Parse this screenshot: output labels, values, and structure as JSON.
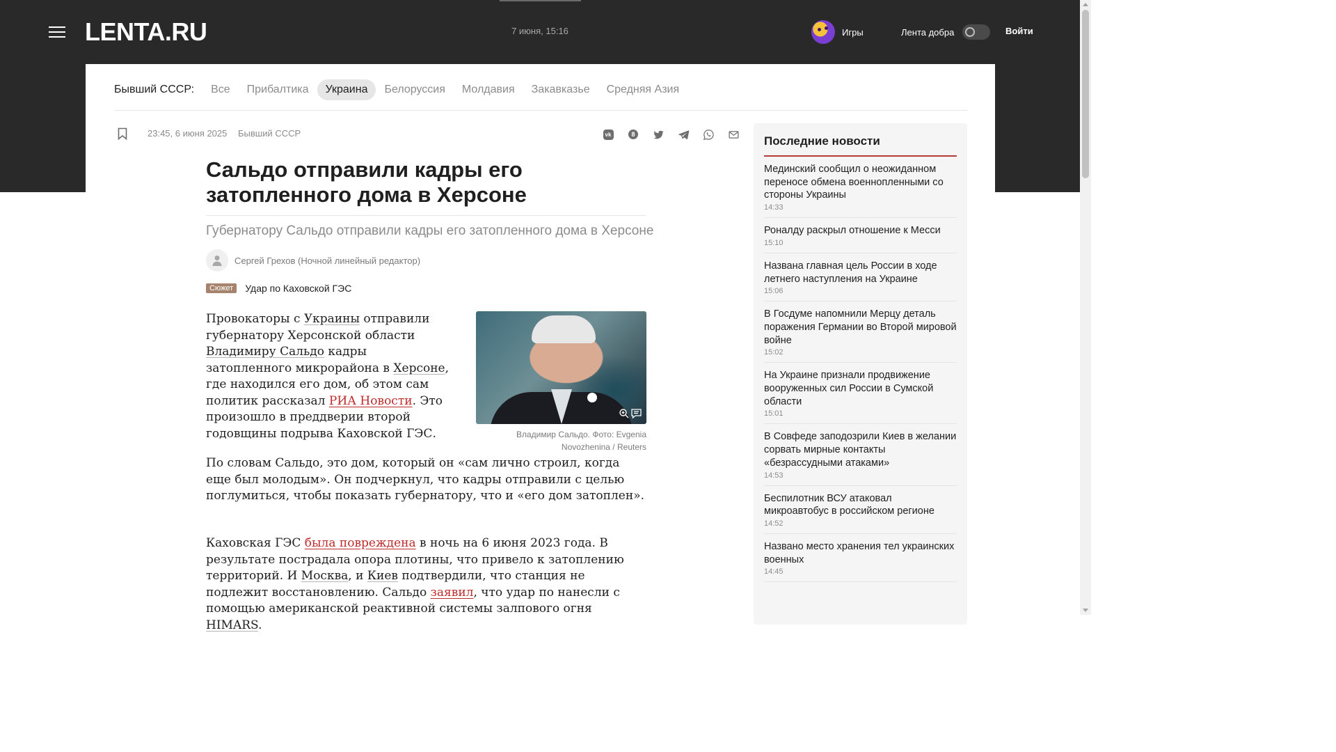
{
  "header": {
    "logo": "LENTA.RU",
    "date": "7 июня, 15:16",
    "games_label": "Игры",
    "kindness_label": "Лента добра",
    "kindness_toggle_on": false,
    "login_label": "Войти",
    "background_color": "#292929"
  },
  "rubrics": {
    "title": "Бывший СССР:",
    "items": [
      {
        "label": "Все",
        "active": false
      },
      {
        "label": "Прибалтика",
        "active": false
      },
      {
        "label": "Украина",
        "active": true
      },
      {
        "label": "Белоруссия",
        "active": false
      },
      {
        "label": "Молдавия",
        "active": false
      },
      {
        "label": "Закавказье",
        "active": false
      },
      {
        "label": "Средняя Азия",
        "active": false
      }
    ]
  },
  "article": {
    "date": "23:45, 6 июня 2025",
    "rubric": "Бывший СССР",
    "share_icons": [
      "vk-icon",
      "odnoklassniki-icon",
      "twitter-icon",
      "telegram-icon",
      "whatsapp-icon",
      "email-icon"
    ],
    "title": "Сальдо отправили кадры его затопленного дома в Херсоне",
    "subtitle": "Губернатору Сальдо отправили кадры его затопленного дома в Херсоне",
    "author": "Сергей Грехов (Ночной линейный редактор)",
    "story_badge": "Сюжет",
    "story_title": "Удар по Каховской ГЭС",
    "photo_caption": "Владимир Сальдо. Фото: Evgenia Novozhenina / Reuters",
    "p1": {
      "t1": "Провокаторы с ",
      "l1": "Украины",
      "t2": " отправили губернатору Херсонской области ",
      "l2": "Владимиру Сальдо",
      "t3": " кадры затопленного микрорайона в ",
      "l3": "Херсоне",
      "t4": ", где находился его дом, об этом сам политик рассказал ",
      "l4": "РИА Новости",
      "t5": ". Это произошло в преддверии второй годовщины подрыва Каховской ГЭС."
    },
    "p2": "По словам Сальдо, это дом, который он «сам лично строил, когда еще был молодым». Он подчеркнул, что кадры отправили с целью поглумиться, чтобы показать губернатору, что и «его дом затоплен».",
    "p3": {
      "t1": "Каховская ГЭС ",
      "l1": "была повреждена",
      "t2": " в ночь на 6 июня 2023 года. В результате пострадала опора плотины, что привело к затоплению территорий. И ",
      "l2": "Москва",
      "t3": ", и ",
      "l3": "Киев",
      "t4": " подтвердили, что станция не подлежит восстановлению. Сальдо ",
      "l4": "заявил",
      "t5": ", что удар по нанесли с помощью американской реактивной системы залпового огня ",
      "l5": "HIMARS",
      "t6": "."
    }
  },
  "sidebar": {
    "title": "Последние новости",
    "news": [
      {
        "title": "Мединский сообщил о неожиданном переносе обмена военнопленными со стороны Украины",
        "time": "14:33"
      },
      {
        "title": "Роналду раскрыл отношение к Месси",
        "time": "15:10"
      },
      {
        "title": "Названа главная цель России в ходе летнего наступления на Украине",
        "time": "15:06"
      },
      {
        "title": "В Госдуме напомнили Мерцу деталь поражения Германии во Второй мировой войне",
        "time": "15:02"
      },
      {
        "title": "На Украине признали продвижение вооруженных сил России в Сумской области",
        "time": "15:01"
      },
      {
        "title": "В Совфеде заподозрили Киев в желании сорвать мирные контакты «безрассудными атаками»",
        "time": "14:53"
      },
      {
        "title": "Беспилотник ВСУ атаковал микроавтобус в российском регионе",
        "time": "14:52"
      },
      {
        "title": "Названо место хранения тел украинских военных",
        "time": "14:45"
      }
    ]
  },
  "colors": {
    "accent_red": "#bf2b2b",
    "sidebar_rule": "#b23a3a",
    "story_badge": "#a5836c"
  }
}
